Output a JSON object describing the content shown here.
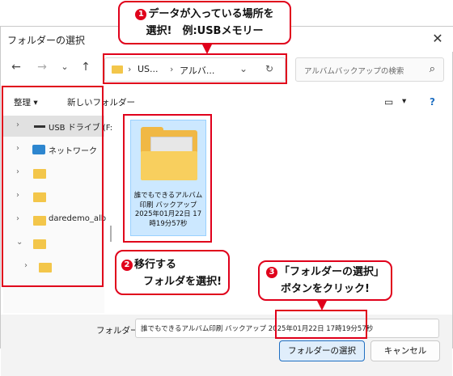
{
  "dialog": {
    "title": "フォルダーの選択"
  },
  "address": {
    "segments": [
      "US...",
      "アルバ..."
    ]
  },
  "search": {
    "placeholder": "アルバムバックアップの検索"
  },
  "toolbar": {
    "organize": "整理 ▾",
    "new_folder": "新しいフォルダー"
  },
  "sidebar": {
    "items": [
      {
        "label": "USB ドライブ (F:",
        "type": "drive",
        "selected": true
      },
      {
        "label": "ネットワーク",
        "type": "network"
      },
      {
        "label": "",
        "type": "folder"
      },
      {
        "label": "",
        "type": "folder"
      },
      {
        "label": "daredemo_alb",
        "type": "folder"
      },
      {
        "label": "",
        "type": "folder",
        "expanded": true
      },
      {
        "label": "",
        "type": "folder"
      }
    ]
  },
  "content": {
    "item_label": "誰でもできるアルバム印刷 バックアップ 2025年01月22日 17時19分57秒"
  },
  "footer": {
    "folder_label": "フォルダー:",
    "folder_value": "誰でもできるアルバム印刷 バックアップ 2025年01月22日 17時19分57秒",
    "select_button": "フォルダーの選択",
    "cancel_button": "キャンセル"
  },
  "annotations": {
    "callout1_num": "1",
    "callout1_text": "データが入っている場所を",
    "callout1_text2": "選択!　例:USBメモリー",
    "callout2_num": "2",
    "callout2_text": "移行する",
    "callout2_text2": "フォルダを選択!",
    "callout3_num": "3",
    "callout3_text": "「フォルダーの選択」",
    "callout3_text2": "ボタンをクリック!",
    "accent_color": "#e0001b"
  }
}
